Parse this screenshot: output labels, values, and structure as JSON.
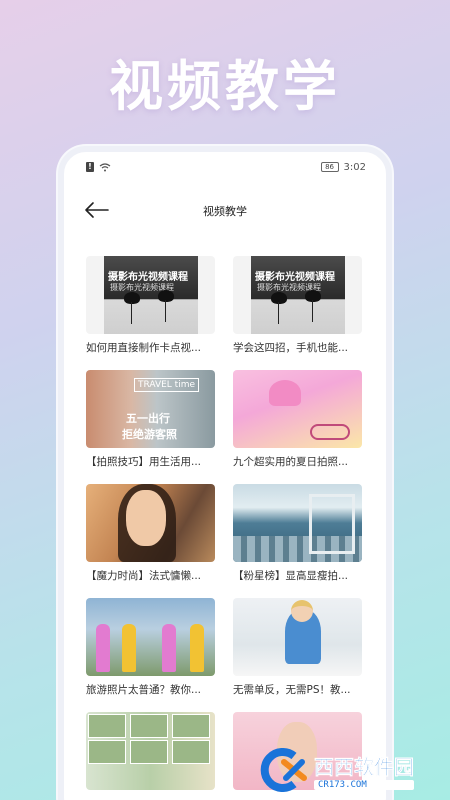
{
  "hero": {
    "title": "视频教学"
  },
  "status_bar": {
    "battery": "86",
    "time": "3:02"
  },
  "nav": {
    "title": "视频教学"
  },
  "videos": [
    {
      "title": "如何用直接制作卡点视...",
      "thumb_text": "摄影布光视频课程",
      "thumb_sub": "摄影布光视频课程"
    },
    {
      "title": "学会这四招，手机也能...",
      "thumb_text": "摄影布光视频课程",
      "thumb_sub": "摄影布光视频课程"
    },
    {
      "title": "【拍照技巧】用生活用...",
      "thumb_text": "TRAVEL time",
      "thumb_sub": "五一出行",
      "thumb_sub2": "拒绝游客照"
    },
    {
      "title": "九个超实用的夏日拍照..."
    },
    {
      "title": "【魔力时尚】法式慵懒..."
    },
    {
      "title": "【粉星榜】显高显瘦拍..."
    },
    {
      "title": "旅游照片太普通？教你..."
    },
    {
      "title": "无需单反，无需PS！教..."
    },
    {
      "title": ""
    },
    {
      "title": ""
    }
  ],
  "watermark": {
    "brand": "西西软件园",
    "url": "CR173.COM"
  },
  "colors": {
    "watermark_blue": "#1a73d9",
    "accent_pink": "#f06a9b"
  }
}
